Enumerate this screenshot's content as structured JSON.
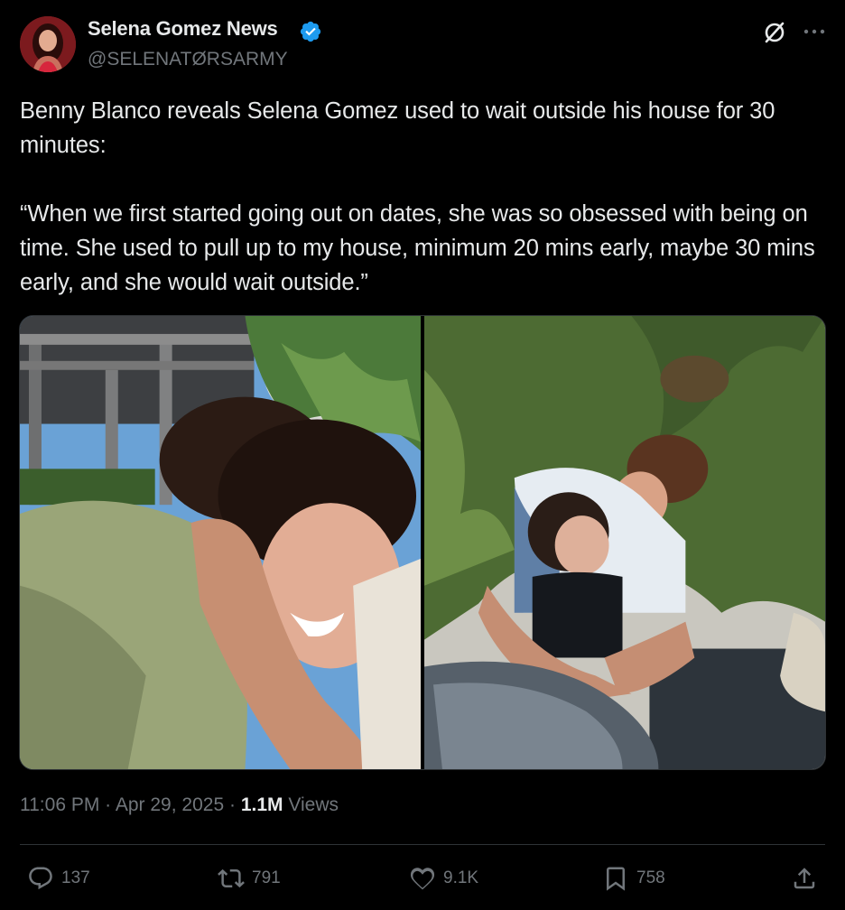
{
  "author": {
    "display_name": "Selena Gomez News",
    "handle": "@SELENATØRSARMY",
    "verified": true
  },
  "tweet": {
    "text": "Benny Blanco reveals Selena Gomez used to wait outside his house for 30 minutes:\n\n“When we first started going out on dates, she was so obsessed with being on time. She used to pull up to my house, minimum 20 mins early, maybe 30 mins early, and she would wait outside.”"
  },
  "media": [
    {
      "description_icon": "photo-couple-hug-garden"
    },
    {
      "description_icon": "photo-couple-kiss-patio"
    }
  ],
  "meta": {
    "time": "11:06 PM",
    "separator": "·",
    "date": "Apr 29, 2025",
    "views_count": "1.1M",
    "views_label": "Views"
  },
  "actions": {
    "replies": "137",
    "reposts": "791",
    "likes": "9.1K",
    "bookmarks": "758"
  },
  "colors": {
    "background": "#000000",
    "text_primary": "#e7e9ea",
    "text_secondary": "#71767b",
    "verified_blue": "#1d9bf0",
    "divider": "#2f3336"
  }
}
